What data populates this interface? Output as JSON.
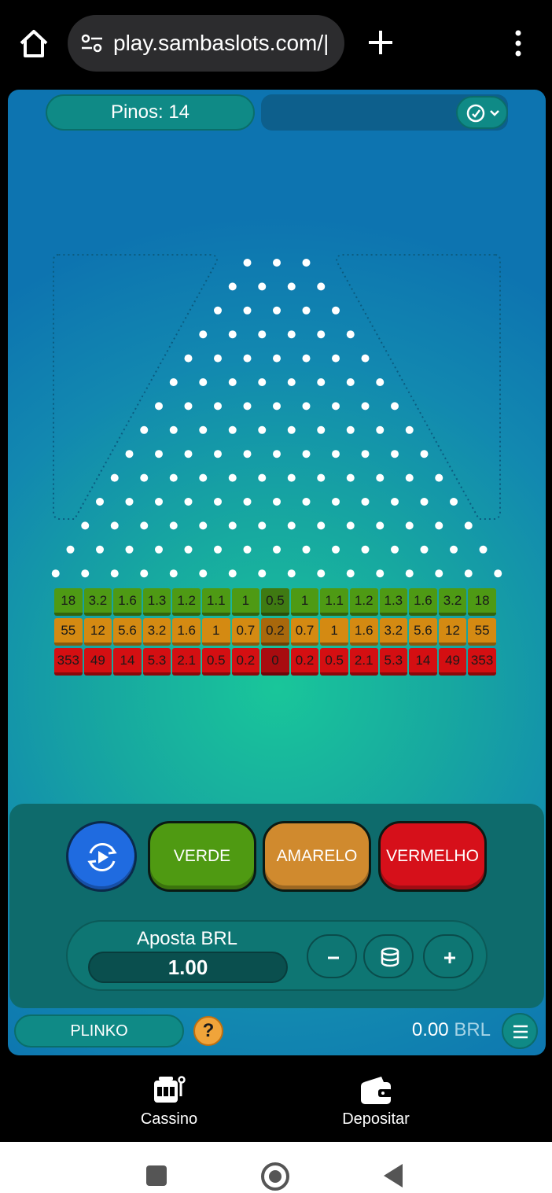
{
  "browser": {
    "url": "play.sambaslots.com/|"
  },
  "game": {
    "pins_label": "Pinos: 14",
    "pin_rows": 14,
    "multipliers": {
      "green": [
        "18",
        "3.2",
        "1.6",
        "1.3",
        "1.2",
        "1.1",
        "1",
        "0.5",
        "1",
        "1.1",
        "1.2",
        "1.3",
        "1.6",
        "3.2",
        "18"
      ],
      "yellow": [
        "55",
        "12",
        "5.6",
        "3.2",
        "1.6",
        "1",
        "0.7",
        "0.2",
        "0.7",
        "1",
        "1.6",
        "3.2",
        "5.6",
        "12",
        "55"
      ],
      "red": [
        "353",
        "49",
        "14",
        "5.3",
        "2.1",
        "0.5",
        "0.2",
        "0",
        "0.2",
        "0.5",
        "2.1",
        "5.3",
        "14",
        "49",
        "353"
      ]
    },
    "buttons": {
      "verde": "VERDE",
      "amarelo": "AMARELO",
      "vermelho": "VERMELHO"
    },
    "bet": {
      "label": "Aposta BRL",
      "value": "1.00"
    },
    "name": "PLINKO",
    "help": "?",
    "balance": {
      "amount": "0.00",
      "currency": "BRL"
    },
    "colors": {
      "green": "#4e9a14",
      "yellow": "#d48a12",
      "red": "#d40f12",
      "panel": "#0e6b6c"
    }
  },
  "sitenav": {
    "cassino": "Cassino",
    "depositar": "Depositar"
  }
}
